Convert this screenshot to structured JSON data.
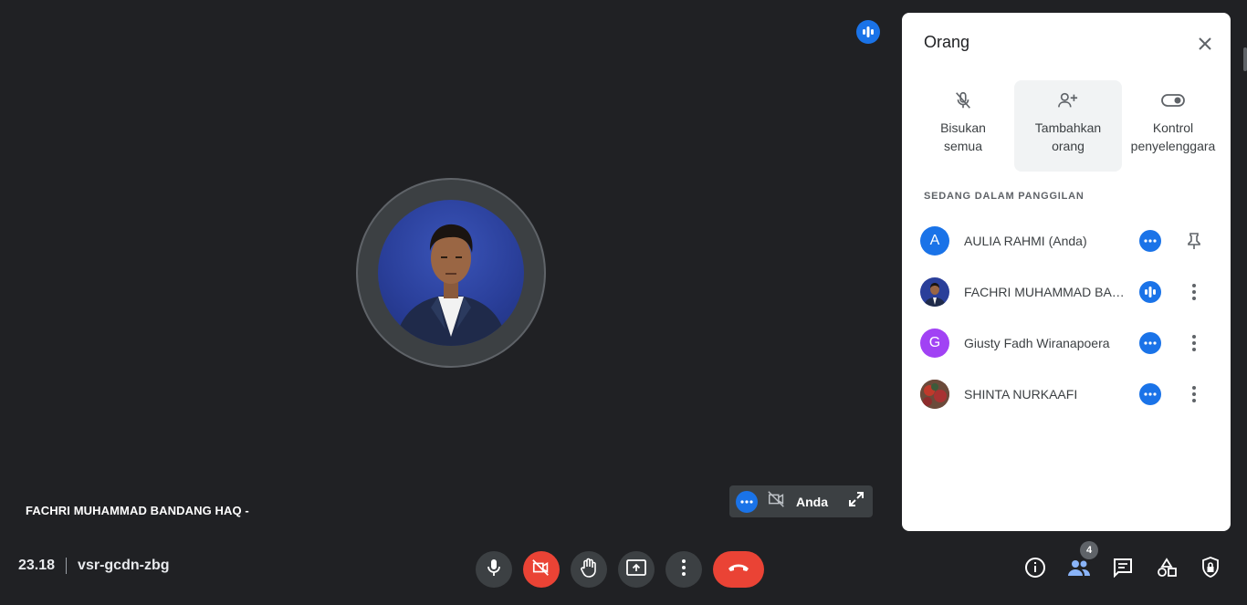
{
  "stage": {
    "speaker_name": "FACHRI MUHAMMAD BANDANG HAQ -",
    "self_label": "Anda"
  },
  "meeting": {
    "time": "23.18",
    "code": "vsr-gcdn-zbg"
  },
  "toolbar": {
    "participant_count": "4"
  },
  "panel": {
    "title": "Orang",
    "actions": [
      {
        "label_line1": "Bisukan",
        "label_line2": "semua",
        "icon": "mic-off-icon"
      },
      {
        "label_line1": "Tambahkan",
        "label_line2": "orang",
        "icon": "person-add-icon"
      },
      {
        "label_line1": "Kontrol",
        "label_line2": "penyelenggara",
        "icon": "toggle-icon"
      }
    ],
    "section_label": "SEDANG DALAM PANGGILAN",
    "people": [
      {
        "name": "AULIA RAHMI (Anda)",
        "initial": "A",
        "avatar_color": "#1a73e8",
        "status": "idle-dots",
        "action": "pin-icon"
      },
      {
        "name": "FACHRI MUHAMMAD BANDANG HAQ",
        "initial": "",
        "avatar_color": "#2a3f9a",
        "status": "speaking",
        "action": "more-vert-icon"
      },
      {
        "name": "Giusty Fadh Wiranapoera",
        "initial": "G",
        "avatar_color": "#a142f4",
        "status": "idle-dots",
        "action": "more-vert-icon"
      },
      {
        "name": "SHINTA NURKAAFI",
        "initial": "",
        "avatar_color": "#7a3b3b",
        "status": "idle-dots",
        "action": "more-vert-icon"
      }
    ]
  },
  "colors": {
    "background": "#202124",
    "accent": "#1a73e8",
    "danger": "#ea4335"
  }
}
